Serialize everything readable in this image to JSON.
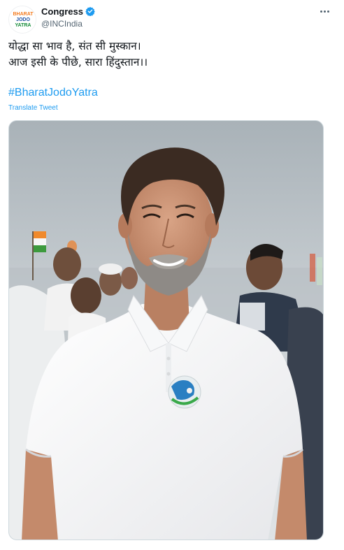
{
  "account": {
    "name": "Congress",
    "handle": "@INCIndia",
    "avatar_icon": "bharat-jodo-yatra-logo",
    "verified_icon": "verified-badge-icon"
  },
  "tweet": {
    "line1": "योद्धा सा भाव है, संत सी मुस्कान।",
    "line2": "आज इसी के पीछे, सारा हिंदुस्तान।।",
    "hashtag": "#BharatJodoYatra",
    "translate_label": "Translate Tweet"
  },
  "media": {
    "icon": "photo-of-smiling-bearded-man-in-white-polo-shirt"
  },
  "colors": {
    "link": "#1d9bf0",
    "text": "#0f1419",
    "secondary": "#536471"
  }
}
